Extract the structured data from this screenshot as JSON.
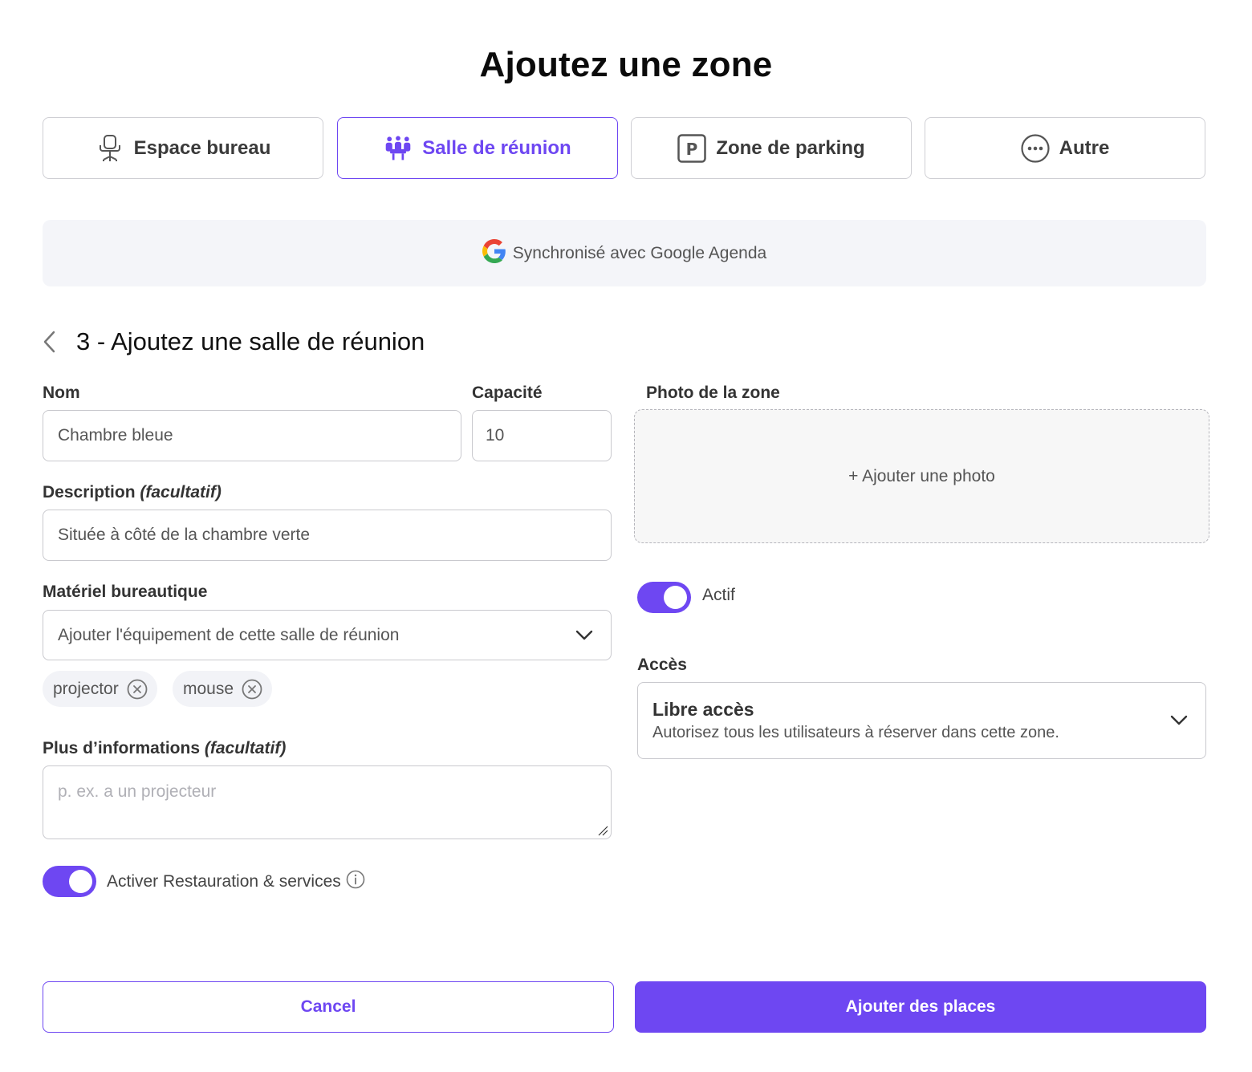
{
  "page": {
    "title": "Ajoutez une zone"
  },
  "zone_types": [
    {
      "label": "Espace bureau",
      "icon": "office-chair-icon"
    },
    {
      "label": "Salle de réunion",
      "icon": "meeting-room-icon",
      "selected": true
    },
    {
      "label": "Zone de parking",
      "icon": "parking-icon"
    },
    {
      "label": "Autre",
      "icon": "more-icon"
    }
  ],
  "sync": {
    "text": "Synchronisé avec Google Agenda",
    "icon": "google-icon"
  },
  "step": {
    "title": "3 - Ajoutez une salle de réunion"
  },
  "form": {
    "name": {
      "label": "Nom",
      "value": "Chambre bleue"
    },
    "capacity": {
      "label": "Capacité",
      "value": "10"
    },
    "description": {
      "label": "Description",
      "optional": "(facultatif)",
      "value": "Située à côté de la chambre verte"
    },
    "equipment": {
      "label": "Matériel bureautique",
      "value": "Ajouter l'équipement de cette salle de réunion",
      "chips": [
        "projector",
        "mouse"
      ]
    },
    "more_info": {
      "label": "Plus d’informations",
      "optional": "(facultatif)",
      "placeholder": "p. ex. a un projecteur"
    },
    "catering": {
      "label": "Activer Restauration & services",
      "enabled": true
    }
  },
  "photo": {
    "label": "Photo de la zone",
    "add_text": "+ Ajouter une photo"
  },
  "active": {
    "label": "Actif",
    "enabled": true
  },
  "access": {
    "label": "Accès",
    "title": "Libre accès",
    "description": "Autorisez tous les utilisateurs à réserver dans cette zone."
  },
  "actions": {
    "cancel": "Cancel",
    "submit": "Ajouter des places"
  },
  "colors": {
    "accent": "#6e47f2",
    "border": "#c9c9ce",
    "sync_bg": "#f4f5f9"
  }
}
